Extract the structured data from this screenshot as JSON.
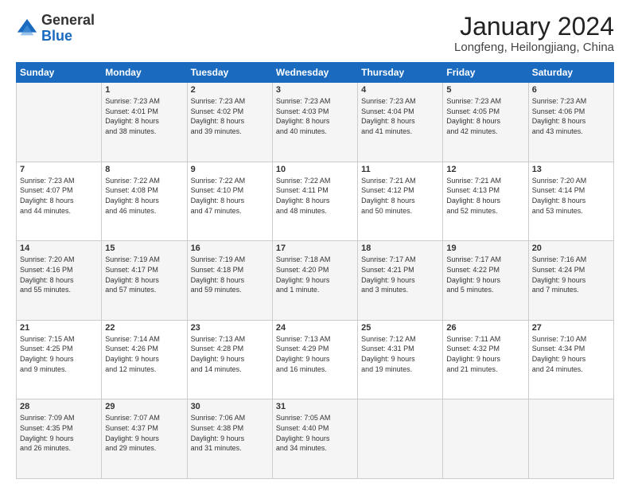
{
  "header": {
    "logo_general": "General",
    "logo_blue": "Blue",
    "title": "January 2024",
    "subtitle": "Longfeng, Heilongjiang, China"
  },
  "columns": [
    "Sunday",
    "Monday",
    "Tuesday",
    "Wednesday",
    "Thursday",
    "Friday",
    "Saturday"
  ],
  "weeks": [
    [
      {
        "day": "",
        "info": ""
      },
      {
        "day": "1",
        "info": "Sunrise: 7:23 AM\nSunset: 4:01 PM\nDaylight: 8 hours\nand 38 minutes."
      },
      {
        "day": "2",
        "info": "Sunrise: 7:23 AM\nSunset: 4:02 PM\nDaylight: 8 hours\nand 39 minutes."
      },
      {
        "day": "3",
        "info": "Sunrise: 7:23 AM\nSunset: 4:03 PM\nDaylight: 8 hours\nand 40 minutes."
      },
      {
        "day": "4",
        "info": "Sunrise: 7:23 AM\nSunset: 4:04 PM\nDaylight: 8 hours\nand 41 minutes."
      },
      {
        "day": "5",
        "info": "Sunrise: 7:23 AM\nSunset: 4:05 PM\nDaylight: 8 hours\nand 42 minutes."
      },
      {
        "day": "6",
        "info": "Sunrise: 7:23 AM\nSunset: 4:06 PM\nDaylight: 8 hours\nand 43 minutes."
      }
    ],
    [
      {
        "day": "7",
        "info": "Sunrise: 7:23 AM\nSunset: 4:07 PM\nDaylight: 8 hours\nand 44 minutes."
      },
      {
        "day": "8",
        "info": "Sunrise: 7:22 AM\nSunset: 4:08 PM\nDaylight: 8 hours\nand 46 minutes."
      },
      {
        "day": "9",
        "info": "Sunrise: 7:22 AM\nSunset: 4:10 PM\nDaylight: 8 hours\nand 47 minutes."
      },
      {
        "day": "10",
        "info": "Sunrise: 7:22 AM\nSunset: 4:11 PM\nDaylight: 8 hours\nand 48 minutes."
      },
      {
        "day": "11",
        "info": "Sunrise: 7:21 AM\nSunset: 4:12 PM\nDaylight: 8 hours\nand 50 minutes."
      },
      {
        "day": "12",
        "info": "Sunrise: 7:21 AM\nSunset: 4:13 PM\nDaylight: 8 hours\nand 52 minutes."
      },
      {
        "day": "13",
        "info": "Sunrise: 7:20 AM\nSunset: 4:14 PM\nDaylight: 8 hours\nand 53 minutes."
      }
    ],
    [
      {
        "day": "14",
        "info": "Sunrise: 7:20 AM\nSunset: 4:16 PM\nDaylight: 8 hours\nand 55 minutes."
      },
      {
        "day": "15",
        "info": "Sunrise: 7:19 AM\nSunset: 4:17 PM\nDaylight: 8 hours\nand 57 minutes."
      },
      {
        "day": "16",
        "info": "Sunrise: 7:19 AM\nSunset: 4:18 PM\nDaylight: 8 hours\nand 59 minutes."
      },
      {
        "day": "17",
        "info": "Sunrise: 7:18 AM\nSunset: 4:20 PM\nDaylight: 9 hours\nand 1 minute."
      },
      {
        "day": "18",
        "info": "Sunrise: 7:17 AM\nSunset: 4:21 PM\nDaylight: 9 hours\nand 3 minutes."
      },
      {
        "day": "19",
        "info": "Sunrise: 7:17 AM\nSunset: 4:22 PM\nDaylight: 9 hours\nand 5 minutes."
      },
      {
        "day": "20",
        "info": "Sunrise: 7:16 AM\nSunset: 4:24 PM\nDaylight: 9 hours\nand 7 minutes."
      }
    ],
    [
      {
        "day": "21",
        "info": "Sunrise: 7:15 AM\nSunset: 4:25 PM\nDaylight: 9 hours\nand 9 minutes."
      },
      {
        "day": "22",
        "info": "Sunrise: 7:14 AM\nSunset: 4:26 PM\nDaylight: 9 hours\nand 12 minutes."
      },
      {
        "day": "23",
        "info": "Sunrise: 7:13 AM\nSunset: 4:28 PM\nDaylight: 9 hours\nand 14 minutes."
      },
      {
        "day": "24",
        "info": "Sunrise: 7:13 AM\nSunset: 4:29 PM\nDaylight: 9 hours\nand 16 minutes."
      },
      {
        "day": "25",
        "info": "Sunrise: 7:12 AM\nSunset: 4:31 PM\nDaylight: 9 hours\nand 19 minutes."
      },
      {
        "day": "26",
        "info": "Sunrise: 7:11 AM\nSunset: 4:32 PM\nDaylight: 9 hours\nand 21 minutes."
      },
      {
        "day": "27",
        "info": "Sunrise: 7:10 AM\nSunset: 4:34 PM\nDaylight: 9 hours\nand 24 minutes."
      }
    ],
    [
      {
        "day": "28",
        "info": "Sunrise: 7:09 AM\nSunset: 4:35 PM\nDaylight: 9 hours\nand 26 minutes."
      },
      {
        "day": "29",
        "info": "Sunrise: 7:07 AM\nSunset: 4:37 PM\nDaylight: 9 hours\nand 29 minutes."
      },
      {
        "day": "30",
        "info": "Sunrise: 7:06 AM\nSunset: 4:38 PM\nDaylight: 9 hours\nand 31 minutes."
      },
      {
        "day": "31",
        "info": "Sunrise: 7:05 AM\nSunset: 4:40 PM\nDaylight: 9 hours\nand 34 minutes."
      },
      {
        "day": "",
        "info": ""
      },
      {
        "day": "",
        "info": ""
      },
      {
        "day": "",
        "info": ""
      }
    ]
  ]
}
